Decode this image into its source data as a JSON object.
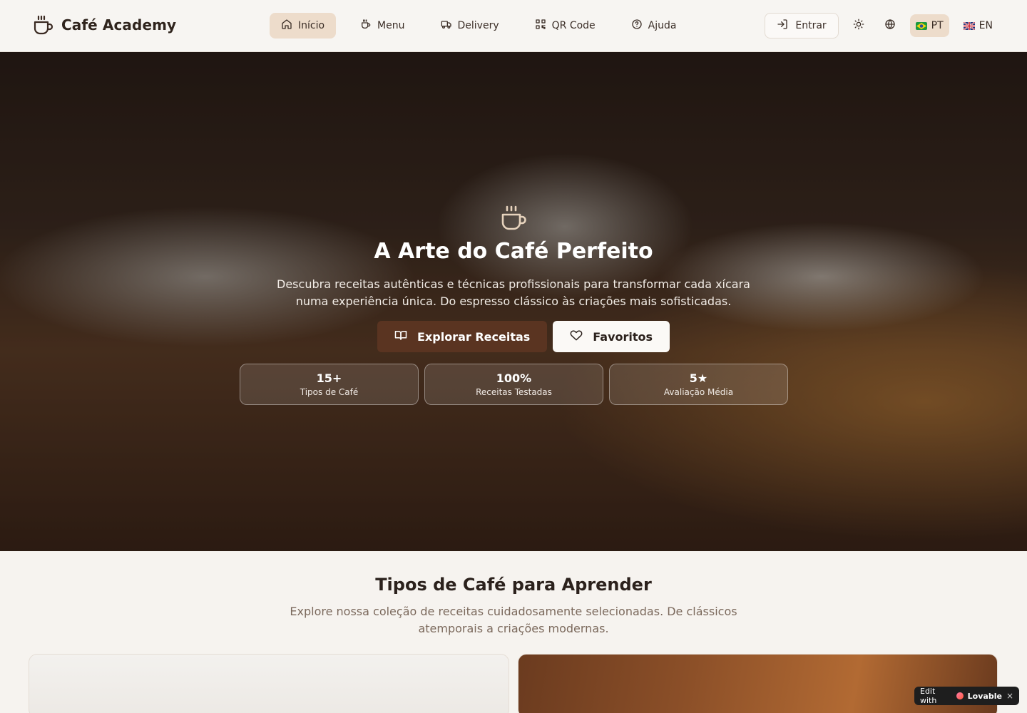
{
  "header": {
    "brand": "Café Academy",
    "nav": [
      {
        "label": "Início",
        "active": true,
        "icon": "home-icon"
      },
      {
        "label": "Menu",
        "active": false,
        "icon": "coffee-icon"
      },
      {
        "label": "Delivery",
        "active": false,
        "icon": "truck-icon"
      },
      {
        "label": "QR Code",
        "active": false,
        "icon": "qr-code-icon"
      },
      {
        "label": "Ajuda",
        "active": false,
        "icon": "help-circle-icon"
      }
    ],
    "login_label": "Entrar",
    "languages": [
      {
        "code": "PT",
        "active": true
      },
      {
        "code": "EN",
        "active": false
      }
    ]
  },
  "hero": {
    "title": "A Arte do Café Perfeito",
    "subtitle": "Descubra receitas autênticas e técnicas profissionais para transformar cada xícara numa experiência única. Do espresso clássico às criações mais sofisticadas.",
    "primary_button": "Explorar Receitas",
    "secondary_button": "Favoritos",
    "stats": [
      {
        "value": "15+",
        "label": "Tipos de Café"
      },
      {
        "value": "100%",
        "label": "Receitas Testadas"
      },
      {
        "value": "5★",
        "label": "Avaliação Média"
      }
    ]
  },
  "types_section": {
    "title": "Tipos de Café para Aprender",
    "subtitle": "Explore nossa coleção de receitas cuidadosamente selecionadas. De clássicos atemporais a criações modernas."
  },
  "badge": {
    "prefix": "Edit with",
    "brand": "Lovable",
    "close": "×"
  },
  "colors": {
    "accent": "#5a3421",
    "active_bg": "#eddccb",
    "page_bg": "#f6f3ef"
  }
}
